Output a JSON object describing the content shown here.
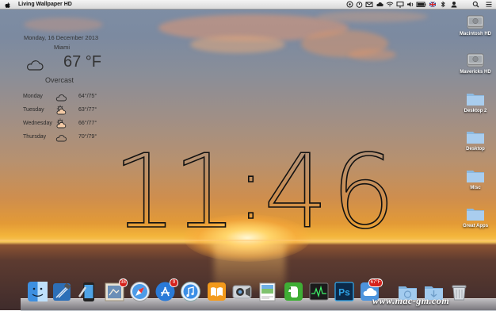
{
  "menubar": {
    "app_name": "Living Wallpaper HD",
    "icons": [
      "apple-icon",
      "status-circle-icon",
      "timer-icon",
      "mail-icon",
      "cloud-icon",
      "display-icon",
      "bluetooth-icon",
      "wifi-icon",
      "airplay-icon",
      "volume-icon",
      "battery-icon",
      "flag-icon",
      "user-icon",
      "spotlight-icon",
      "notification-center-icon"
    ]
  },
  "weather": {
    "date": "Monday, 16 December 2013",
    "city": "Miami",
    "temperature": "67 °F",
    "condition": "Overcast",
    "forecast": [
      {
        "day": "Monday",
        "icon": "cloudy-icon",
        "temps": "64°/75°"
      },
      {
        "day": "Tuesday",
        "icon": "partly-sunny-icon",
        "temps": "63°/77°"
      },
      {
        "day": "Wednesday",
        "icon": "partly-sunny-icon",
        "temps": "66°/77°"
      },
      {
        "day": "Thursday",
        "icon": "cloudy-icon",
        "temps": "70°/79°"
      }
    ]
  },
  "clock": {
    "h1": "1",
    "h2": "1",
    "sep": ":",
    "m1": "4",
    "m2": "6"
  },
  "desktop_icons": [
    {
      "label": "Macintosh HD",
      "type": "drive"
    },
    {
      "label": "Mavericks HD",
      "type": "drive"
    },
    {
      "label": "Desktop 2",
      "type": "folder"
    },
    {
      "label": "Desktop",
      "type": "folder"
    },
    {
      "label": "Misc",
      "type": "folder"
    },
    {
      "label": "Great Apps",
      "type": "folder"
    }
  ],
  "dock": {
    "apps": [
      "finder-icon",
      "xcode-icon",
      "iphone-simulator-icon",
      "mail-stamp-icon",
      "safari-icon",
      "app-store-icon",
      "itunes-icon",
      "ibooks-icon",
      "facetime-camera-icon",
      "preview-icon",
      "evernote-icon",
      "activity-monitor-icon",
      "photoshop-icon",
      "weather-app-icon",
      "applications-folder-icon",
      "downloads-folder-icon",
      "trash-icon"
    ],
    "badges": {
      "mail": "38",
      "app_store": "9",
      "weather": "67°F"
    },
    "photoshop_label": "Ps"
  },
  "watermark": "www.mac-gm.com",
  "colors": {
    "sky_top": "#7e8ea5",
    "sun": "#f6c65a",
    "sea": "#3f2c2c",
    "clock_stroke": "#111111",
    "badge": "#d6221c"
  }
}
